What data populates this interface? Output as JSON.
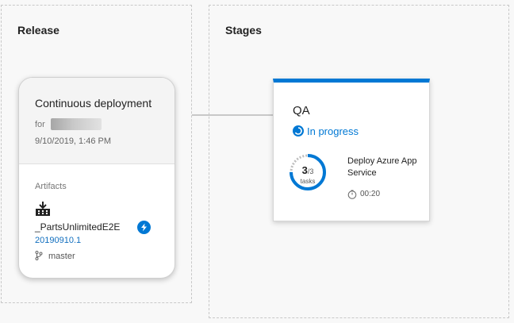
{
  "release_panel": {
    "title": "Release"
  },
  "stages_panel": {
    "title": "Stages"
  },
  "release_card": {
    "title": "Continuous deployment",
    "for_label": "for",
    "date": "9/10/2019, 1:46 PM",
    "artifacts_label": "Artifacts",
    "artifact": {
      "name": "_PartsUnlimitedE2E",
      "version": "20190910.1",
      "branch": "master",
      "icon": "build-artifact-icon",
      "trigger_icon": "lightning-icon"
    }
  },
  "stage": {
    "name": "QA",
    "status": "In progress",
    "status_icon": "in-progress-icon",
    "tasks_done": "3",
    "tasks_total": "/3",
    "tasks_unit": "tasks",
    "progress_fraction": 0.75,
    "task_name": "Deploy Azure App Service",
    "duration": "00:20",
    "timer_icon": "timer-icon"
  },
  "colors": {
    "accent": "#0078d4",
    "link": "#106ebe",
    "border": "#c8c8c8"
  }
}
